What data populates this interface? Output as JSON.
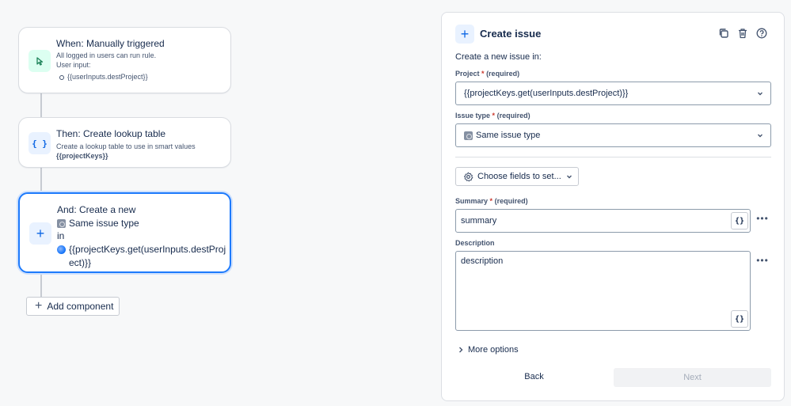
{
  "flow": {
    "trigger": {
      "title": "When: Manually triggered",
      "desc": "All logged in users can run rule.",
      "input_label": "User input:",
      "inputs": [
        "{{userInputs.destProject}}"
      ]
    },
    "lookup": {
      "title": "Then: Create lookup table",
      "desc": "Create a lookup table to use in smart values",
      "var": "{{projectKeys}}"
    },
    "action": {
      "line1": "And: Create a new",
      "issue_type": "Same issue type",
      "in_label": "in",
      "project_line1": "{{projectKeys.get(userInputs.destProj",
      "project_line2": "ect)}}"
    },
    "add_component": "Add component"
  },
  "panel": {
    "title": "Create issue",
    "intro": "Create a new issue in:",
    "project": {
      "label": "Project",
      "required_mark": "*",
      "required": "(required)",
      "value": "{{projectKeys.get(userInputs.destProject)}}"
    },
    "issue_type": {
      "label": "Issue type",
      "required_mark": "*",
      "required": "(required)",
      "value": "Same issue type"
    },
    "choose_fields": "Choose fields to set...",
    "summary": {
      "label": "Summary",
      "required_mark": "*",
      "required": "(required)",
      "value": "summary"
    },
    "description": {
      "label": "Description",
      "value": "description"
    },
    "smart_value_glyph": "{}",
    "more_options": "More options",
    "back": "Back",
    "next": "Next"
  },
  "colors": {
    "accent": "#1d7afc",
    "trigger_icon": "#1f845a",
    "required": "#c9372c"
  },
  "icons": [
    "pointer-click-icon",
    "braces-icon",
    "plus-icon",
    "copy-icon",
    "trash-icon",
    "help-icon",
    "gear-icon",
    "chevron-down-icon",
    "chevron-right-icon",
    "more-icon"
  ]
}
